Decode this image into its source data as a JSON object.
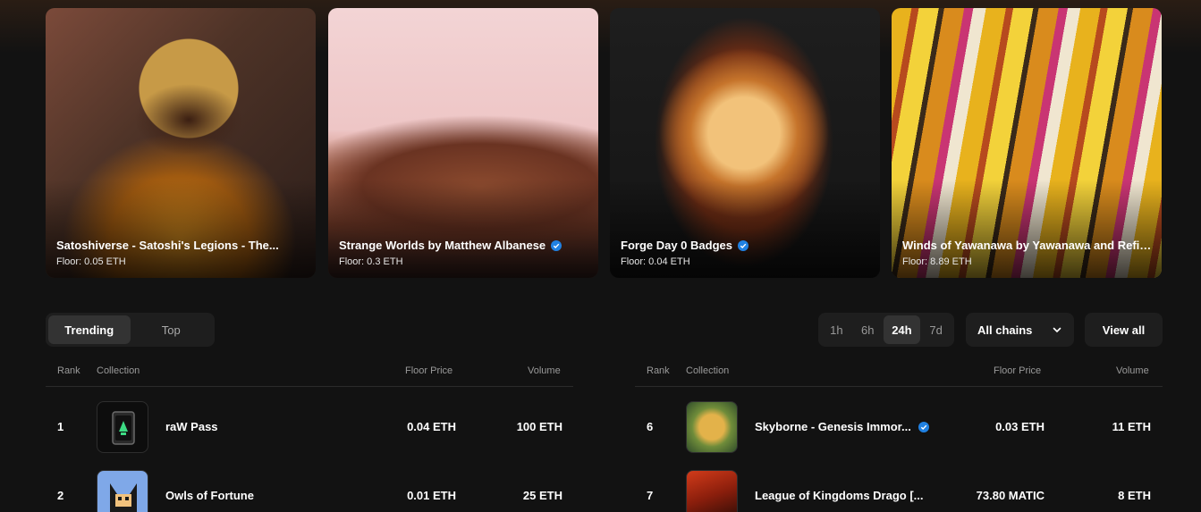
{
  "featured": [
    {
      "title": "Satoshiverse - Satoshi's Legions - The...",
      "verified": false,
      "floor": "Floor: 0.05 ETH"
    },
    {
      "title": "Strange Worlds by Matthew Albanese",
      "verified": true,
      "floor": "Floor: 0.3 ETH"
    },
    {
      "title": "Forge Day 0 Badges",
      "verified": true,
      "floor": "Floor: 0.04 ETH"
    },
    {
      "title": "Winds of Yawanawa by Yawanawa and Refik...",
      "verified": false,
      "floor": "Floor: 8.89 ETH"
    }
  ],
  "tabs": {
    "trending": "Trending",
    "top": "Top"
  },
  "timeframes": [
    "1h",
    "6h",
    "24h",
    "7d"
  ],
  "selected_timeframe": "24h",
  "chains_label": "All chains",
  "view_all": "View all",
  "table_headers": {
    "rank": "Rank",
    "collection": "Collection",
    "floor": "Floor Price",
    "volume": "Volume"
  },
  "left_rows": [
    {
      "rank": "1",
      "name": "raW Pass",
      "verified": false,
      "floor": "0.04 ETH",
      "volume": "100 ETH"
    },
    {
      "rank": "2",
      "name": "Owls of Fortune",
      "verified": false,
      "floor": "0.01 ETH",
      "volume": "25 ETH"
    }
  ],
  "right_rows": [
    {
      "rank": "6",
      "name": "Skyborne - Genesis Immor...",
      "verified": true,
      "floor": "0.03 ETH",
      "volume": "11 ETH"
    },
    {
      "rank": "7",
      "name": "League of Kingdoms Drago [...",
      "verified": false,
      "floor": "73.80 MATIC",
      "volume": "8 ETH"
    }
  ],
  "colors": {
    "background": "#121212",
    "accent": "#2081e2",
    "control": "#1e1e1e"
  }
}
